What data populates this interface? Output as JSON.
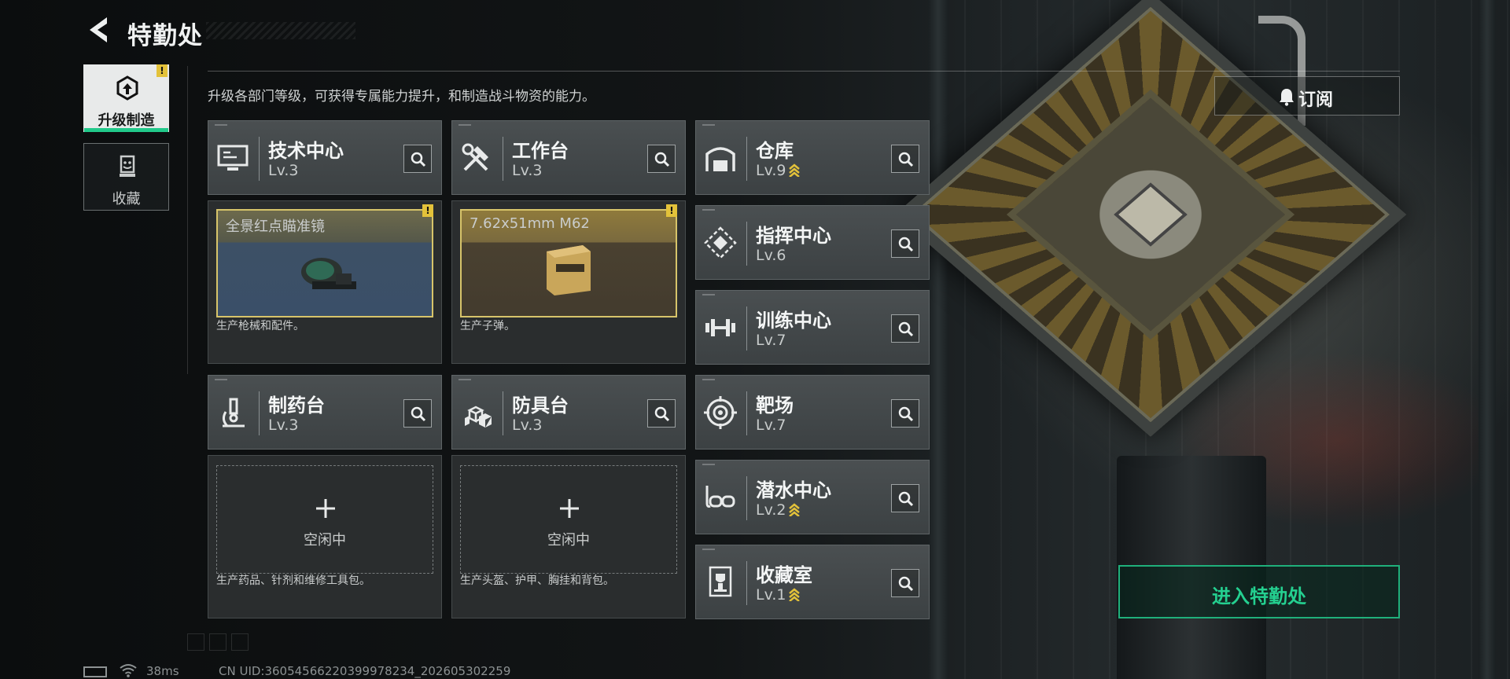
{
  "header": {
    "title": "特勤处"
  },
  "tabs": [
    {
      "label": "升级制造",
      "active": true,
      "alert": "!"
    },
    {
      "label": "收藏",
      "active": false
    }
  ],
  "description": "升级各部门等级，可获得专属能力提升，和制造战斗物资的能力。",
  "subscribe": {
    "label": "订阅"
  },
  "buildings": {
    "tech_center": {
      "name": "技术中心",
      "level": "Lv.3"
    },
    "workbench": {
      "name": "工作台",
      "level": "Lv.3"
    },
    "warehouse": {
      "name": "仓库",
      "level": "Lv.9",
      "upgradable": true
    },
    "command_center": {
      "name": "指挥中心",
      "level": "Lv.6"
    },
    "training_center": {
      "name": "训练中心",
      "level": "Lv.7"
    },
    "pharmacy": {
      "name": "制药台",
      "level": "Lv.3"
    },
    "armor_bench": {
      "name": "防具台",
      "level": "Lv.3"
    },
    "range": {
      "name": "靶场",
      "level": "Lv.7"
    },
    "dive_center": {
      "name": "潜水中心",
      "level": "Lv.2",
      "upgradable": true
    },
    "collection_room": {
      "name": "收藏室",
      "level": "Lv.1",
      "upgradable": true
    }
  },
  "production": {
    "tech_center": {
      "item": "全景红点瞄准镜",
      "footer": "生产枪械和配件。",
      "alert": "!"
    },
    "workbench": {
      "item": "7.62x51mm M62",
      "footer": "生产子弹。",
      "alert": "!"
    },
    "pharmacy": {
      "status": "空闲中",
      "footer": "生产药品、针剂和维修工具包。"
    },
    "armor_bench": {
      "status": "空闲中",
      "footer": "生产头盔、护甲、胸挂和背包。"
    }
  },
  "enter_button": {
    "label": "进入特勤处"
  },
  "status_bar": {
    "ping": "38ms",
    "uid": "CN UID:3605456622039997823​4_202605302259"
  },
  "colors": {
    "accent": "#21c98a",
    "warning": "#e3c23a",
    "upgrade": "#e3c23a"
  }
}
